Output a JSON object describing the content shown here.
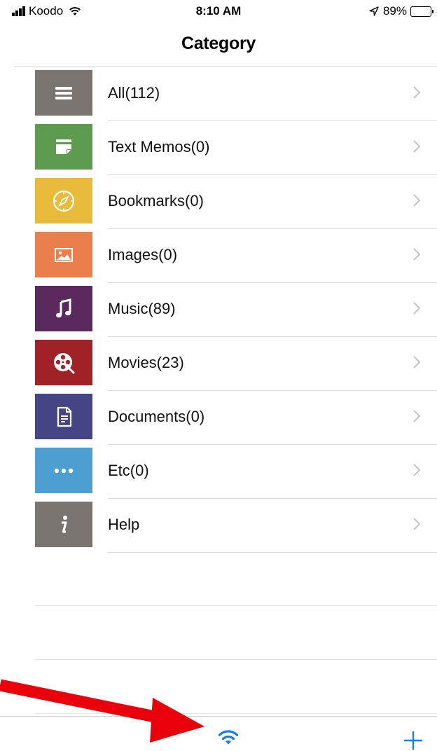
{
  "status_bar": {
    "carrier": "Koodo",
    "time": "8:10 AM",
    "battery_percent": "89%",
    "battery_level": 0.89,
    "icons": [
      "cellular-signal-icon",
      "wifi-icon",
      "location-arrow-icon",
      "battery-icon"
    ]
  },
  "nav": {
    "title": "Category"
  },
  "categories": [
    {
      "label": "All(112)",
      "color": "#7a7570",
      "icon": "list-icon"
    },
    {
      "label": "Text Memos(0)",
      "color": "#5d9b4e",
      "icon": "memo-icon"
    },
    {
      "label": "Bookmarks(0)",
      "color": "#e9bb3a",
      "icon": "compass-icon"
    },
    {
      "label": "Images(0)",
      "color": "#ea7f4d",
      "icon": "image-icon"
    },
    {
      "label": "Music(89)",
      "color": "#5a2a5e",
      "icon": "music-note-icon"
    },
    {
      "label": "Movies(23)",
      "color": "#a02226",
      "icon": "film-reel-icon"
    },
    {
      "label": "Documents(0)",
      "color": "#454584",
      "icon": "document-icon"
    },
    {
      "label": "Etc(0)",
      "color": "#4c9fd0",
      "icon": "more-dots-icon"
    },
    {
      "label": "Help",
      "color": "#7a7570",
      "icon": "info-icon"
    }
  ],
  "toolbar": {
    "icons": [
      "wifi-transfer-icon",
      "plus-icon"
    ],
    "accent_color": "#1a7cf5"
  },
  "annotation": {
    "arrow_color": "#e8000b"
  }
}
